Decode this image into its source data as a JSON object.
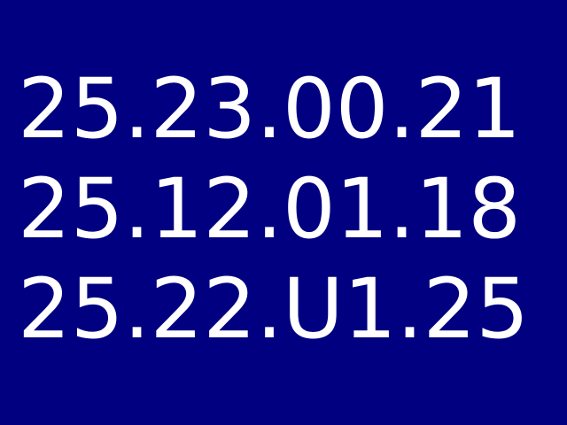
{
  "display": {
    "background_color": "#000080",
    "text_color": "#ffffff",
    "lines": [
      "25.23.00.21",
      "25.12.01.18",
      "25.22.U1.25"
    ]
  }
}
